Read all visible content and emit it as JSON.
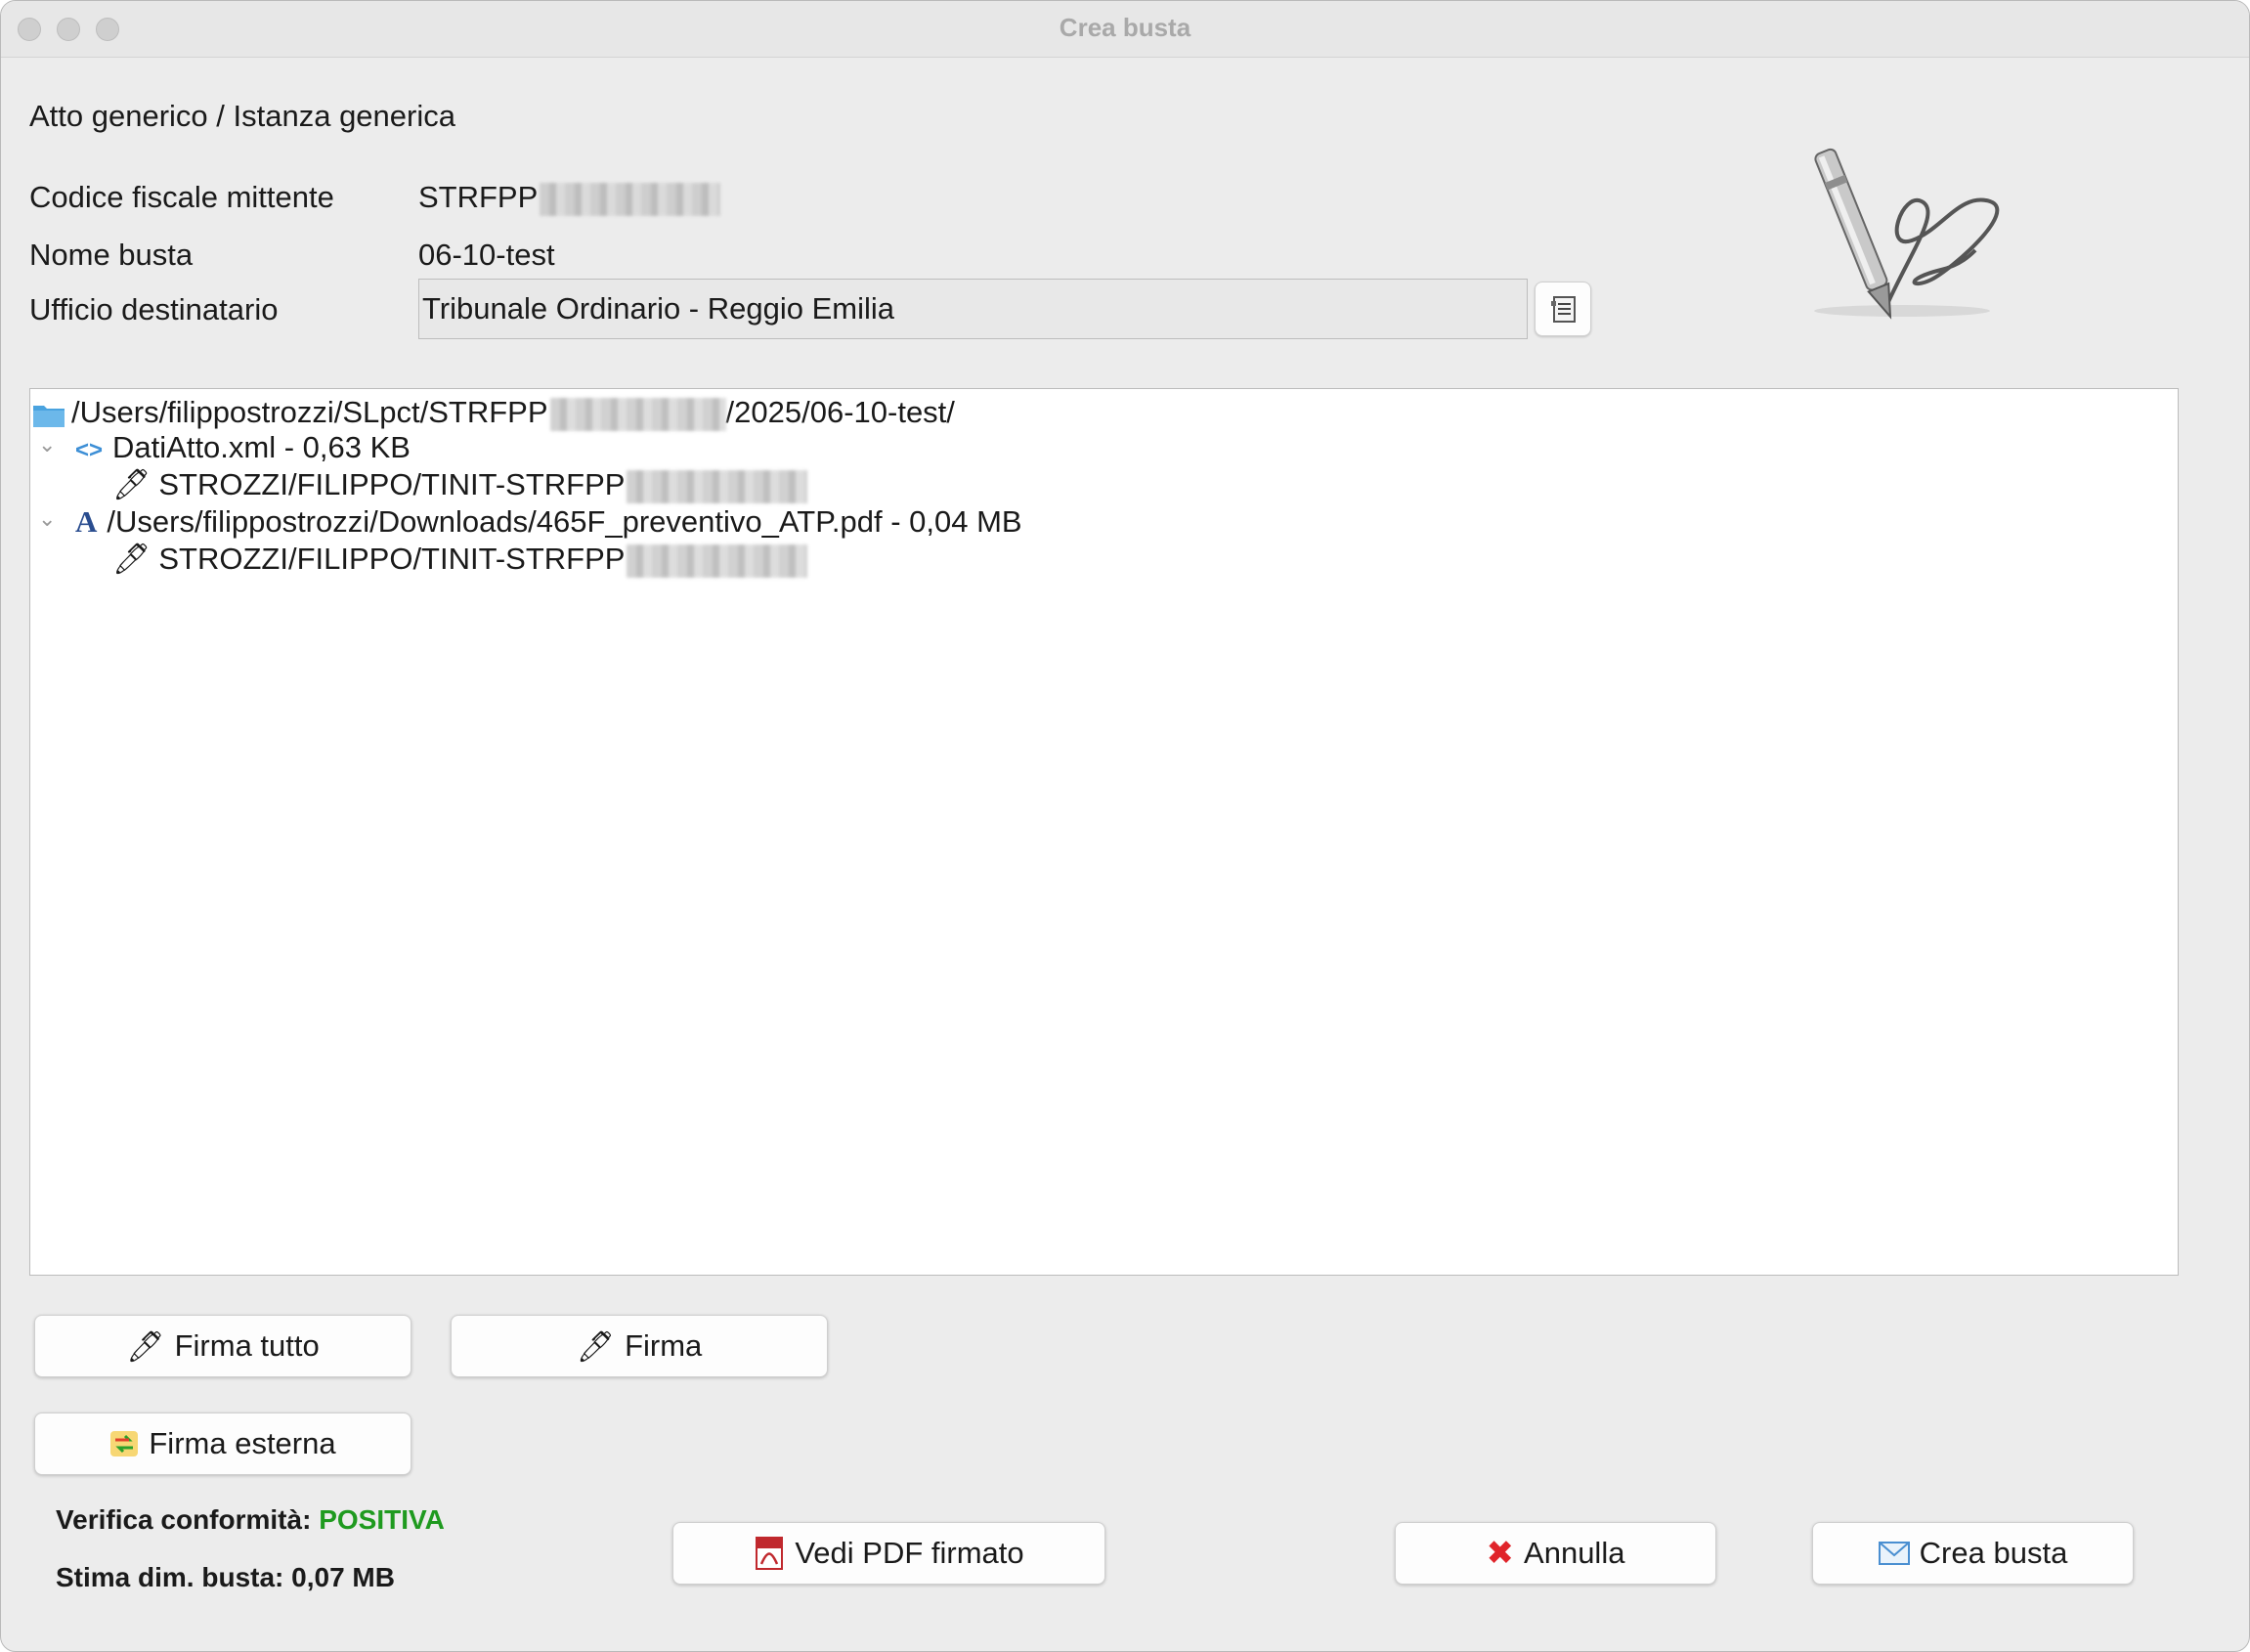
{
  "window": {
    "title": "Crea busta"
  },
  "header": {
    "doc_type": "Atto generico / Istanza generica"
  },
  "form": {
    "cf_label": "Codice fiscale mittente",
    "cf_value": "STRFPP",
    "name_label": "Nome busta",
    "name_value": "06-10-test",
    "office_label": "Ufficio destinatario",
    "office_value": "Tribunale Ordinario - Reggio Emilia"
  },
  "tree": {
    "root_prefix": "/Users/filippostrozzi/SLpct/STRFPP",
    "root_suffix": "/2025/06-10-test/",
    "items": [
      {
        "label": "DatiAtto.xml - 0,63 KB",
        "signature": "STROZZI/FILIPPO/TINIT-STRFPP"
      },
      {
        "label": "/Users/filippostrozzi/Downloads/465F_preventivo_ATP.pdf - 0,04 MB",
        "signature": "STROZZI/FILIPPO/TINIT-STRFPP"
      }
    ]
  },
  "buttons": {
    "sign_all": "Firma tutto",
    "sign": "Firma",
    "sign_external": "Firma esterna",
    "view_pdf": "Vedi PDF firmato",
    "cancel": "Annulla",
    "create": "Crea busta"
  },
  "status": {
    "conformity_label": "Verifica conformità:",
    "conformity_value": "POSITIVA",
    "size_label": "Stima dim. busta:",
    "size_value": "0,07 MB"
  },
  "colors": {
    "positive": "#1f9a1f",
    "folder": "#4aa3df",
    "xml_icon": "#3d8fd6",
    "cancel_icon": "#e0242a"
  }
}
